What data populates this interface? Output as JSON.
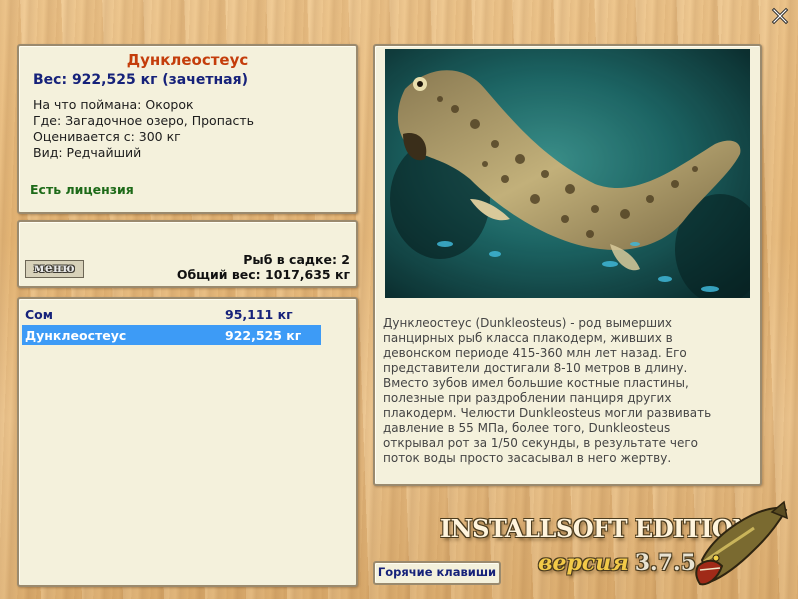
{
  "fish": {
    "name": "Дунклеостеус",
    "weight": "Вес: 922,525 кг (зачетная)",
    "bait": "На что поймана: Окорок",
    "location": "Где: Загадочное озеро, Пропасть",
    "value": "Оценивается с: 300 кг",
    "rarity": "Вид: Редчайший",
    "license": "Есть лицензия"
  },
  "stats": {
    "menu_label": "меню",
    "count": "Рыб в садке: 2",
    "total": "Общий вес: 1017,635 кг"
  },
  "catch_list": [
    {
      "name": "Сом",
      "weight": "95,111 кг",
      "selected": false
    },
    {
      "name": "Дунклеостеус",
      "weight": "922,525 кг",
      "selected": true
    }
  ],
  "description": "Дунклеостеус (Dunkleosteus) - род вымерших панцирных рыб класса плакодерм, живших в девонском периоде 415-360 млн лет назад. Его представители достигали 8-10 метров в длину. Вместо зубов имел большие костные пластины, полезные при раздроблении панциря других плакодерм. Челюсти Dunkleosteus могли развивать давление в 55 МПа, более того, Dunkleosteus открывал рот за 1/50 секунды, в результате чего поток воды просто засасывал в него жертву.",
  "hotkeys_label": "Горячие клавиши",
  "branding": {
    "edition": "INSTALLSOFT EDITION",
    "version_word": "версия",
    "version_number": "3.7.5"
  },
  "colors": {
    "title_orange": "#c43d0b",
    "navy": "#16227a",
    "license_green": "#1d6a18",
    "selection_blue": "#3d9bf6",
    "panel_bg": "#f4f1dc"
  },
  "icons": [
    "close-icon",
    "fish-photo",
    "pike-logo"
  ]
}
